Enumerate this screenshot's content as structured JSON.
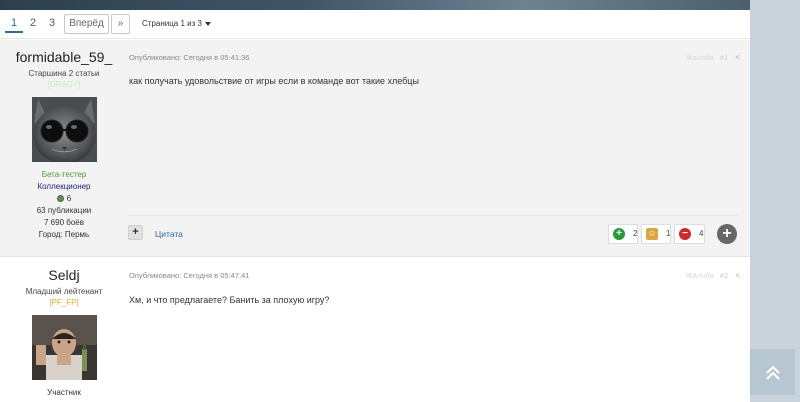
{
  "pagination": {
    "pages": [
      "1",
      "2",
      "3"
    ],
    "active_page": "1",
    "next_label": "Вперёд",
    "last_label": "»",
    "page_info": "Страница 1 из 3"
  },
  "posts": [
    {
      "username": "formidable_59_",
      "rank": "Старшина 2 статьи",
      "clan": "[DRAGY]",
      "clan_color": "#c8ecc0",
      "badge": "Бета-тестер",
      "badge_color": "#4a9a3a",
      "title": "Коллекционер",
      "title_color": "#23237a",
      "reputation": "6",
      "publications": "63 публикации",
      "battles": "7 690 боёв",
      "city": "Город: Пермь",
      "published": "Опубликовано: Сегодня в 05:41:36",
      "number": "#1",
      "faded_label": "Жалоба",
      "text": "как получать удовольствие от игры если в команде вот такие хлебцы",
      "quote_label": "Цитата",
      "reactions": [
        {
          "icon": "plus-reaction-icon",
          "count": "2",
          "color": "#2a9a3a"
        },
        {
          "icon": "emoji-reaction-icon",
          "count": "1",
          "color": "#d9a640"
        },
        {
          "icon": "minus-reaction-icon",
          "count": "4",
          "color": "#c92a2a"
        }
      ]
    },
    {
      "username": "Seldj",
      "rank": "Младший лейтенант",
      "clan": "[PF_FP]",
      "clan_color": "#e0a830",
      "badge": "Участник",
      "published": "Опубликовано: Сегодня в 05:47:41",
      "number": "#2",
      "faded_label": "Жалоба",
      "text": "Хм, и что предлагаете? Банить за плохую игру?"
    }
  ],
  "scroll_top_icon": "chevron-double-up-icon"
}
